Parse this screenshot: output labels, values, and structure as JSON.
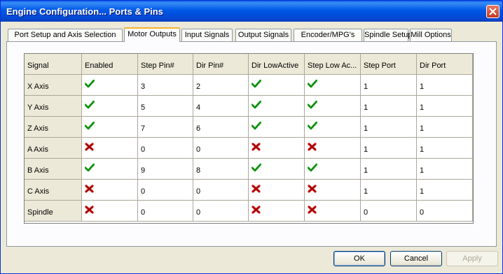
{
  "window": {
    "title": "Engine Configuration... Ports & Pins"
  },
  "tabs": [
    {
      "label": "Port Setup and Axis Selection",
      "active": false
    },
    {
      "label": "Motor Outputs",
      "active": true
    },
    {
      "label": "Input Signals",
      "active": false
    },
    {
      "label": "Output Signals",
      "active": false
    },
    {
      "label": "Encoder/MPG's",
      "active": false
    },
    {
      "label": "Spindle Setup",
      "active": false
    },
    {
      "label": "Mill Options",
      "active": false
    }
  ],
  "grid": {
    "columns": [
      "Signal",
      "Enabled",
      "Step Pin#",
      "Dir Pin#",
      "Dir LowActive",
      "Step Low Ac...",
      "Step Port",
      "Dir Port"
    ],
    "rows": [
      {
        "signal": "X Axis",
        "enabled": "check",
        "step_pin": "3",
        "dir_pin": "2",
        "dir_low": "check",
        "step_low": "check",
        "step_port": "1",
        "dir_port": "1"
      },
      {
        "signal": "Y Axis",
        "enabled": "check",
        "step_pin": "5",
        "dir_pin": "4",
        "dir_low": "check",
        "step_low": "check",
        "step_port": "1",
        "dir_port": "1"
      },
      {
        "signal": "Z Axis",
        "enabled": "check",
        "step_pin": "7",
        "dir_pin": "6",
        "dir_low": "check",
        "step_low": "check",
        "step_port": "1",
        "dir_port": "1"
      },
      {
        "signal": "A Axis",
        "enabled": "cross",
        "step_pin": "0",
        "dir_pin": "0",
        "dir_low": "cross",
        "step_low": "cross",
        "step_port": "1",
        "dir_port": "1"
      },
      {
        "signal": "B Axis",
        "enabled": "check",
        "step_pin": "9",
        "dir_pin": "8",
        "dir_low": "check",
        "step_low": "check",
        "step_port": "1",
        "dir_port": "1"
      },
      {
        "signal": "C Axis",
        "enabled": "cross",
        "step_pin": "0",
        "dir_pin": "0",
        "dir_low": "cross",
        "step_low": "cross",
        "step_port": "1",
        "dir_port": "1"
      },
      {
        "signal": "Spindle",
        "enabled": "cross",
        "step_pin": "0",
        "dir_pin": "0",
        "dir_low": "cross",
        "step_low": "cross",
        "step_port": "0",
        "dir_port": "0"
      }
    ]
  },
  "buttons": {
    "ok": "OK",
    "cancel": "Cancel",
    "apply": "Apply"
  },
  "colors": {
    "check": "#1fae1f",
    "cross": "#d01010",
    "title_bar": "#0058e6"
  }
}
